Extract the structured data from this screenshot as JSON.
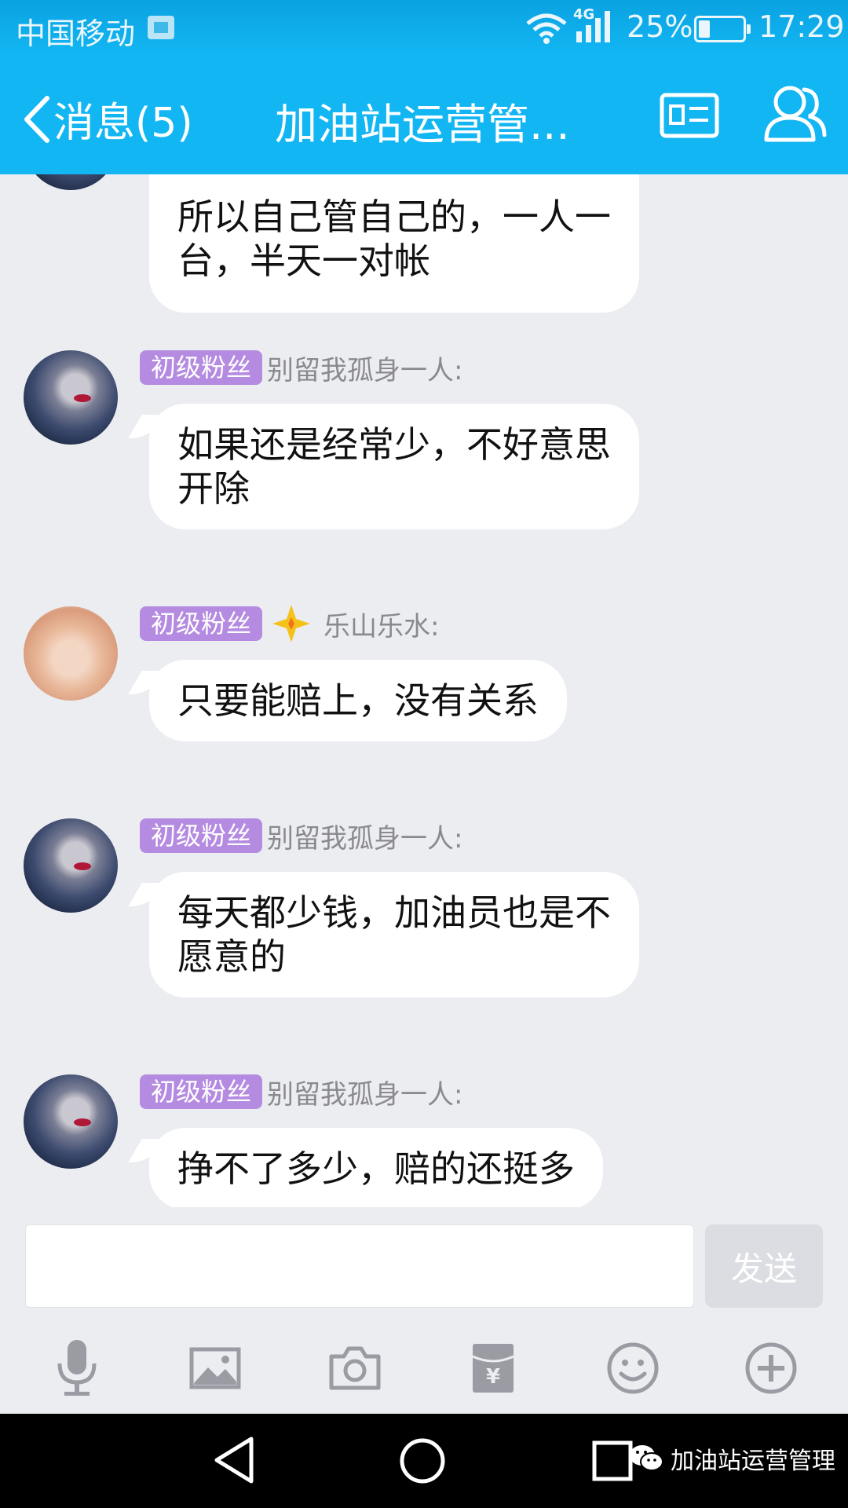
{
  "status_bar": {
    "carrier": "中国移动",
    "network": "4G",
    "battery": "25%",
    "time": "17:29"
  },
  "nav": {
    "back_label": "消息(5)",
    "title": "加油站运营管..."
  },
  "messages": [
    {
      "bubble_lines": [
        "所以自己管自己的，一人一",
        "台，半天一对帐"
      ]
    },
    {
      "badge": "初级粉丝",
      "sender": "别留我孤身一人:",
      "bubble_lines": [
        "如果还是经常少，不好意思",
        "开除"
      ]
    },
    {
      "badge": "初级粉丝",
      "sender": "乐山乐水:",
      "bubble_lines": [
        "只要能赔上，没有关系"
      ]
    },
    {
      "badge": "初级粉丝",
      "sender": "别留我孤身一人:",
      "bubble_lines": [
        "每天都少钱，加油员也是不",
        "愿意的"
      ]
    },
    {
      "badge": "初级粉丝",
      "sender": "别留我孤身一人:",
      "bubble_lines": [
        "挣不了多少，赔的还挺多"
      ]
    }
  ],
  "composer": {
    "value": "",
    "send_label": "发送"
  },
  "toolbar_icons": [
    "microphone-icon",
    "image-icon",
    "camera-icon",
    "red-packet-icon",
    "emoji-icon",
    "plus-icon"
  ],
  "watermark": "加油站运营管理",
  "colors": {
    "header": "#12b6f2",
    "badge": "#b48be0",
    "background": "#ecedf1"
  }
}
